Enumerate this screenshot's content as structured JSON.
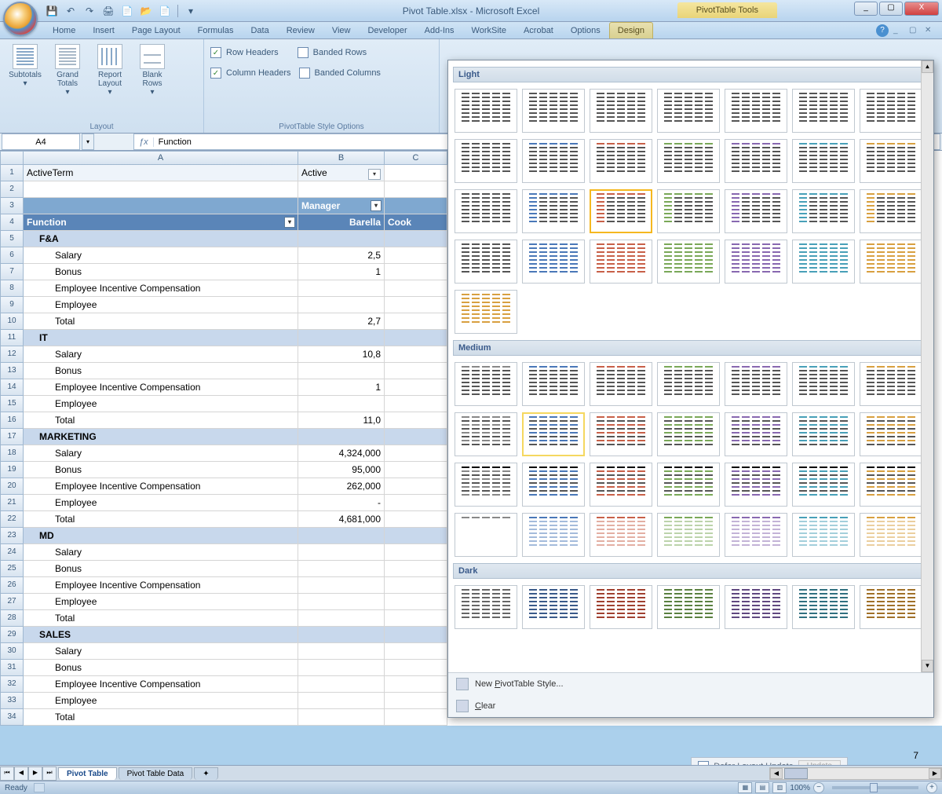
{
  "app": {
    "title": "Pivot Table.xlsx - Microsoft Excel",
    "contextual_title": "PivotTable Tools"
  },
  "qat": {
    "save": "💾",
    "undo": "↶",
    "redo": "↷",
    "print": "🖨",
    "preview": "📄",
    "open": "📂",
    "new": "📄"
  },
  "win": {
    "min": "_",
    "max": "▢",
    "close": "X"
  },
  "tabs": [
    "Home",
    "Insert",
    "Page Layout",
    "Formulas",
    "Data",
    "Review",
    "View",
    "Developer",
    "Add-Ins",
    "WorkSite",
    "Acrobat",
    "Options",
    "Design"
  ],
  "ribbon": {
    "layout_group": "Layout",
    "subtotals": "Subtotals",
    "grand_totals": "Grand Totals",
    "report_layout": "Report Layout",
    "blank_rows": "Blank Rows",
    "style_options_group": "PivotTable Style Options",
    "row_headers": "Row Headers",
    "column_headers": "Column Headers",
    "banded_rows": "Banded Rows",
    "banded_columns": "Banded Columns"
  },
  "formula": {
    "name_box": "A4",
    "fx": "ƒx",
    "value": "Function"
  },
  "columns": [
    "A",
    "B",
    "C"
  ],
  "pivot": {
    "report_filter_label": "ActiveTerm",
    "report_filter_value": "Active",
    "col_field": "Manager",
    "row_field": "Function",
    "col_items": [
      "Barella",
      "Cook"
    ],
    "row_lines": [
      "Salary",
      "Bonus",
      "Employee Incentive Compensation",
      "Employee",
      "Total"
    ],
    "groups": [
      {
        "name": "F&A",
        "b": [
          "",
          "2,5",
          "1",
          "",
          "",
          "2,7"
        ]
      },
      {
        "name": "IT",
        "b": [
          "",
          "10,8",
          "",
          "1",
          "",
          "11,0"
        ]
      },
      {
        "name": "MARKETING",
        "b": [
          "",
          "4,324,000",
          "95,000",
          "262,000",
          "-",
          "4,681,000"
        ]
      },
      {
        "name": "MD",
        "b": [
          "",
          "",
          "",
          "",
          "",
          ""
        ]
      },
      {
        "name": "SALES",
        "b": [
          "",
          "",
          "",
          "",
          "",
          ""
        ]
      }
    ],
    "trailing_value": "7"
  },
  "gallery": {
    "sections": [
      "Light",
      "Medium",
      "Dark"
    ],
    "new_style": "New PivotTable Style...",
    "clear": "Clear",
    "mnemonic_new": "P",
    "mnemonic_clear": "C",
    "light_colors": [
      "#555",
      "#4a78b8",
      "#c86048",
      "#7aa858",
      "#8868b0",
      "#48a0b8",
      "#d8a040"
    ],
    "medium_colors": [
      "#888",
      "#4a78b8",
      "#c86048",
      "#7aa858",
      "#8868b0",
      "#48a0b8",
      "#d8a040"
    ],
    "dark_colors": [
      "#666",
      "#3a5a8a",
      "#a04030",
      "#5a8040",
      "#604880",
      "#307080",
      "#a07028"
    ]
  },
  "sheet_tabs": {
    "active": "Pivot Table",
    "tabs": [
      "Pivot Table",
      "Pivot Table Data"
    ]
  },
  "status": {
    "ready": "Ready",
    "zoom": "100%",
    "defer": "Defer Layout Update",
    "update": "Update"
  }
}
